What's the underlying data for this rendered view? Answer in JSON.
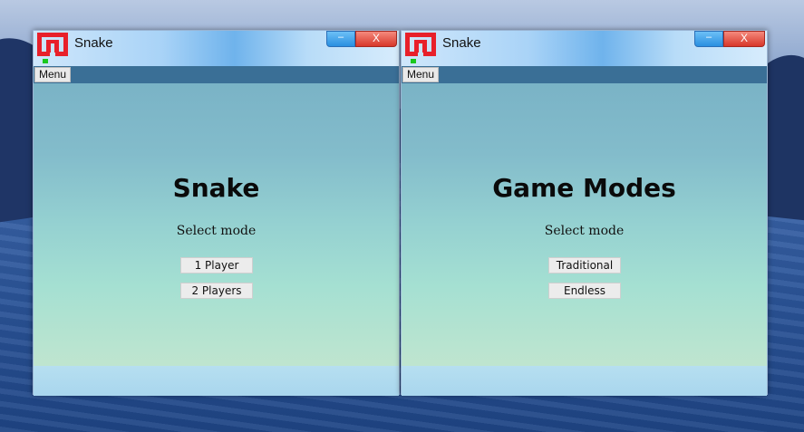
{
  "windows": [
    {
      "title": "Snake",
      "controls": {
        "minimize": "–",
        "close": "X"
      },
      "menu_label": "Menu",
      "heading": "Snake",
      "subtitle": "Select mode",
      "buttons": [
        "1 Player",
        "2 Players"
      ]
    },
    {
      "title": "Snake",
      "controls": {
        "minimize": "–",
        "close": "X"
      },
      "menu_label": "Menu",
      "heading": "Game Modes",
      "subtitle": "Select mode",
      "buttons": [
        "Traditional",
        "Endless"
      ]
    }
  ],
  "icons": {
    "app": "snake-app-icon",
    "minimize": "minimize-icon",
    "close": "close-icon"
  },
  "colors": {
    "icon_red": "#e8202a",
    "icon_green": "#19c81e",
    "menubar": "#3a6f96",
    "close_red": "#d7372a",
    "minimize_blue": "#2a8fe0"
  }
}
